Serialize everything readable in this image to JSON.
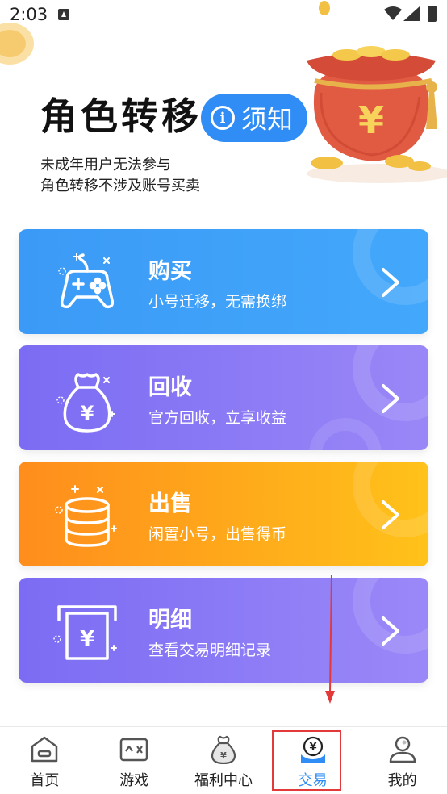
{
  "status_bar": {
    "time": "2:03"
  },
  "header": {
    "title": "角色转移",
    "notice_button_icon": "i",
    "notice_button_label": "须知",
    "subtitle_lines": [
      "未成年用户无法参与",
      "角色转移不涉及账号买卖"
    ]
  },
  "cards": [
    {
      "title": "购买",
      "subtitle": "小号迁移，无需换绑",
      "icon": "gamepad-icon",
      "color": "#3b9af6"
    },
    {
      "title": "回收",
      "subtitle": "官方回收，立享收益",
      "icon": "money-bag-icon",
      "color": "#7b6cf3"
    },
    {
      "title": "出售",
      "subtitle": "闲置小号，出售得币",
      "icon": "coin-stack-icon",
      "color": "#ff9a1a"
    },
    {
      "title": "明细",
      "subtitle": "查看交易明细记录",
      "icon": "receipt-icon",
      "color": "#7b6cf3"
    }
  ],
  "tab_bar": {
    "items": [
      {
        "label": "首页",
        "icon": "home-icon"
      },
      {
        "label": "游戏",
        "icon": "game-icon"
      },
      {
        "label": "福利中心",
        "icon": "welfare-bag-icon"
      },
      {
        "label": "交易",
        "icon": "trade-icon",
        "active": true
      },
      {
        "label": "我的",
        "icon": "profile-icon"
      }
    ],
    "active_color": "#2f8df5"
  },
  "annotation": {
    "highlight_color": "#e23a3a"
  }
}
